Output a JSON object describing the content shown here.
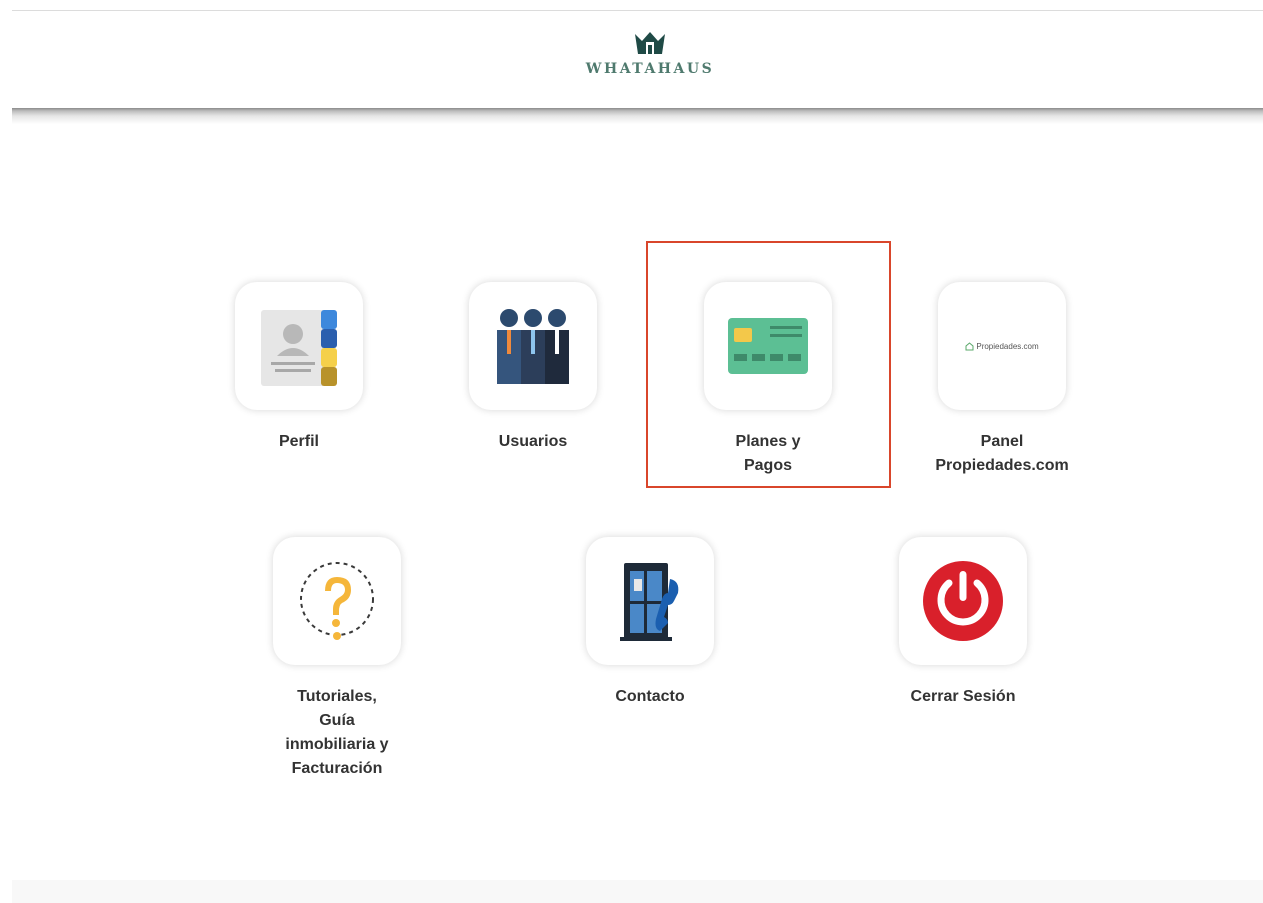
{
  "brand": {
    "name": "WHATAHAUS",
    "color": "#4f7a6e",
    "icon": "crown-house-icon"
  },
  "highlight_color": "#d9462b",
  "menu": {
    "items": [
      {
        "id": "perfil",
        "label": "Perfil",
        "icon": "contact-book-icon"
      },
      {
        "id": "usuarios",
        "label": "Usuarios",
        "icon": "users-group-icon"
      },
      {
        "id": "planes",
        "label": "Planes y\nPagos",
        "icon": "credit-card-icon",
        "highlighted": true
      },
      {
        "id": "propiedades",
        "label": "Panel\nPropiedades.com",
        "icon": "propiedades-logo",
        "logo_text": "Propiedades.com"
      },
      {
        "id": "tutoriales",
        "label": "Tutoriales,\nGuía\ninmobiliaria y\nFacturación",
        "icon": "question-mark-icon"
      },
      {
        "id": "contacto",
        "label": "Contacto",
        "icon": "phone-booth-icon"
      },
      {
        "id": "cerrar",
        "label": "Cerrar Sesión",
        "icon": "power-icon"
      }
    ]
  }
}
